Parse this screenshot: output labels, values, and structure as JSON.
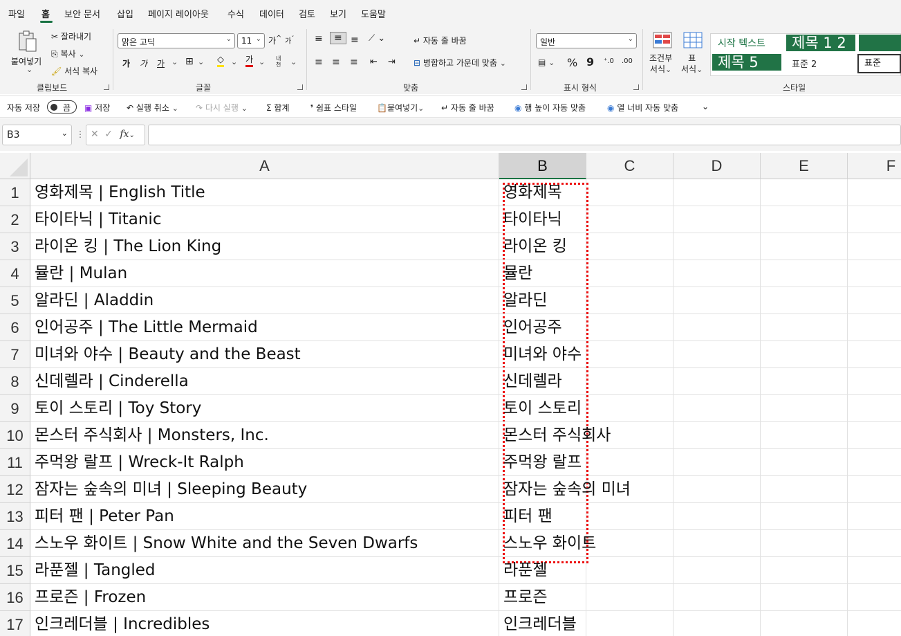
{
  "menu": {
    "tabs": [
      "파일",
      "홈",
      "보안 문서",
      "삽입",
      "페이지 레이아웃",
      "수식",
      "데이터",
      "검토",
      "보기",
      "도움말"
    ],
    "active": "홈"
  },
  "ribbon": {
    "clipboard": {
      "paste": "붙여넣기",
      "cut": "잘라내기",
      "copy": "복사",
      "format_painter": "서식 복사",
      "label": "클립보드"
    },
    "font": {
      "font_name": "맑은 고딕",
      "font_size": "11",
      "grow": "가",
      "shrink": "가",
      "bold": "가",
      "italic": "가",
      "underline": "가",
      "color_letter": "가",
      "phonetic": "내천",
      "label": "글꼴"
    },
    "alignment": {
      "wrap": "자동 줄 바꿈",
      "merge": "병합하고 가운데 맞춤",
      "label": "맞춤"
    },
    "number": {
      "format": "일반",
      "percent": "%",
      "comma": "9",
      "label": "표시 형식"
    },
    "styles": {
      "conditional": "조건부 서식",
      "conditional_line1": "조건부",
      "conditional_line2": "서식",
      "table_line1": "표",
      "table_line2": "서식",
      "cell_styles": [
        "시작 텍스트",
        "제목 1 2",
        "",
        "제목 5",
        "표준 2",
        "표준"
      ],
      "label": "스타일",
      "accent": "#217346"
    }
  },
  "qat": {
    "autosave": "자동 저장",
    "autosave_state": "끔",
    "save": "저장",
    "undo": "실행 취소",
    "redo": "다시 실행",
    "sum": "합계",
    "comma_style": "쉼표 스타일",
    "paste": "붙여넣기",
    "wrap": "자동 줄 바꿈",
    "row_autofit": "행 높이 자동 맞춤",
    "col_autofit": "열 너비 자동 맞춤"
  },
  "formula_bar": {
    "name_box": "B3",
    "fx": "fx",
    "value": ""
  },
  "grid": {
    "columns": [
      "A",
      "B",
      "C",
      "D",
      "E",
      "F"
    ],
    "rows": [
      {
        "n": "1",
        "a": "영화제목 | English Title",
        "b": "영화제목"
      },
      {
        "n": "2",
        "a": "타이타닉 | Titanic",
        "b": "타이타닉"
      },
      {
        "n": "3",
        "a": "라이온 킹 | The Lion King",
        "b": "라이온 킹"
      },
      {
        "n": "4",
        "a": "뮬란 | Mulan",
        "b": "뮬란"
      },
      {
        "n": "5",
        "a": "알라딘 | Aladdin",
        "b": "알라딘"
      },
      {
        "n": "6",
        "a": "인어공주 | The Little Mermaid",
        "b": "인어공주"
      },
      {
        "n": "7",
        "a": "미녀와 야수 | Beauty and the Beast",
        "b": "미녀와 야수"
      },
      {
        "n": "8",
        "a": "신데렐라 | Cinderella",
        "b": "신데렐라"
      },
      {
        "n": "9",
        "a": "토이 스토리 | Toy Story",
        "b": "토이 스토리"
      },
      {
        "n": "10",
        "a": "몬스터 주식회사 | Monsters, Inc.",
        "b": "몬스터 주식회사"
      },
      {
        "n": "11",
        "a": "주먹왕 랄프 | Wreck-It Ralph",
        "b": "주먹왕 랄프"
      },
      {
        "n": "12",
        "a": "잠자는 숲속의 미녀 | Sleeping Beauty",
        "b": "잠자는 숲속의 미녀"
      },
      {
        "n": "13",
        "a": "피터 팬 | Peter Pan",
        "b": "피터 팬"
      },
      {
        "n": "14",
        "a": "스노우 화이트 | Snow White and the Seven Dwarfs",
        "b": "스노우 화이트"
      },
      {
        "n": "15",
        "a": "라푼젤 | Tangled",
        "b": "라푼젤"
      },
      {
        "n": "16",
        "a": "프로즌 | Frozen",
        "b": "프로즌"
      },
      {
        "n": "17",
        "a": "인크레더블 | Incredibles",
        "b": "인크레더블"
      }
    ]
  },
  "colors": {
    "selection_border": "#ee1111",
    "excel_green": "#1a7343"
  }
}
